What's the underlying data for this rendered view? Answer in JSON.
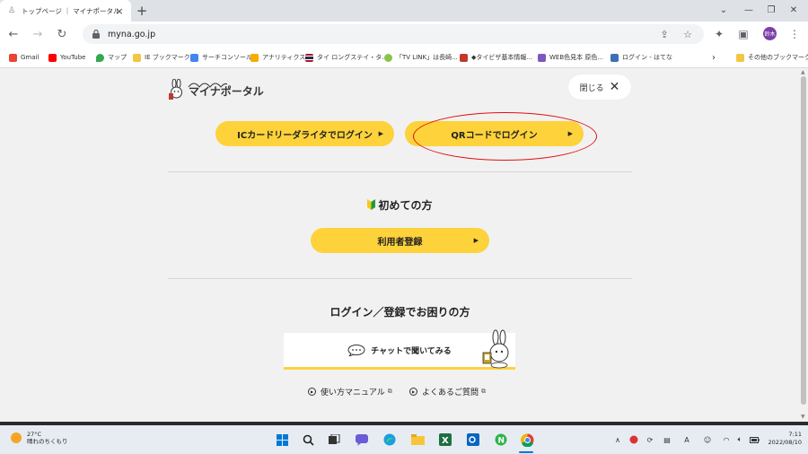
{
  "browser": {
    "tab_title": "トップページ ｜ マイナポータル",
    "url": "myna.go.jp",
    "profile_initials": "鈴木"
  },
  "bookmarks": [
    {
      "label": "Gmail",
      "color": "#ea4335"
    },
    {
      "label": "YouTube",
      "color": "#ff0000"
    },
    {
      "label": "マップ",
      "color": "#34a853"
    },
    {
      "label": "IE ブックマーク",
      "color": "#f4c542"
    },
    {
      "label": "サーチコンソール",
      "color": "#4285f4"
    },
    {
      "label": "アナリティクス",
      "color": "#f9ab00"
    },
    {
      "label": "タイ ロングステイ・タ...",
      "color": "#1a3a8f"
    },
    {
      "label": "「TV LINK」は長崎...",
      "color": "#8bc34a"
    },
    {
      "label": "◆タイビザ基本情報...",
      "color": "#c0392b"
    },
    {
      "label": "WEB色見本 原色...",
      "color": "#7e57c2"
    },
    {
      "label": "ログイン - はてな",
      "color": "#3d6fb6"
    }
  ],
  "bookmarks_other": "その他のブックマーク",
  "page": {
    "logo_text": "マイナポータル",
    "close_label": "閉じる",
    "ic_login_label": "ICカードリーダライタでログイン",
    "qr_login_label": "QRコードでログイン",
    "first_time_heading": "初めての方",
    "register_label": "利用者登録",
    "trouble_heading": "ログイン／登録でお困りの方",
    "chat_label": "チャットで聞いてみる",
    "manual_link": "使い方マニュアル",
    "faq_link": "よくあるご質問"
  },
  "colors": {
    "accent_yellow": "#fdd23a",
    "annotation_red": "#e01010"
  },
  "taskbar": {
    "temperature": "27°C",
    "weather": "晴れのちくもり",
    "time": "7:11",
    "date": "2022/08/10",
    "ime": "A"
  }
}
